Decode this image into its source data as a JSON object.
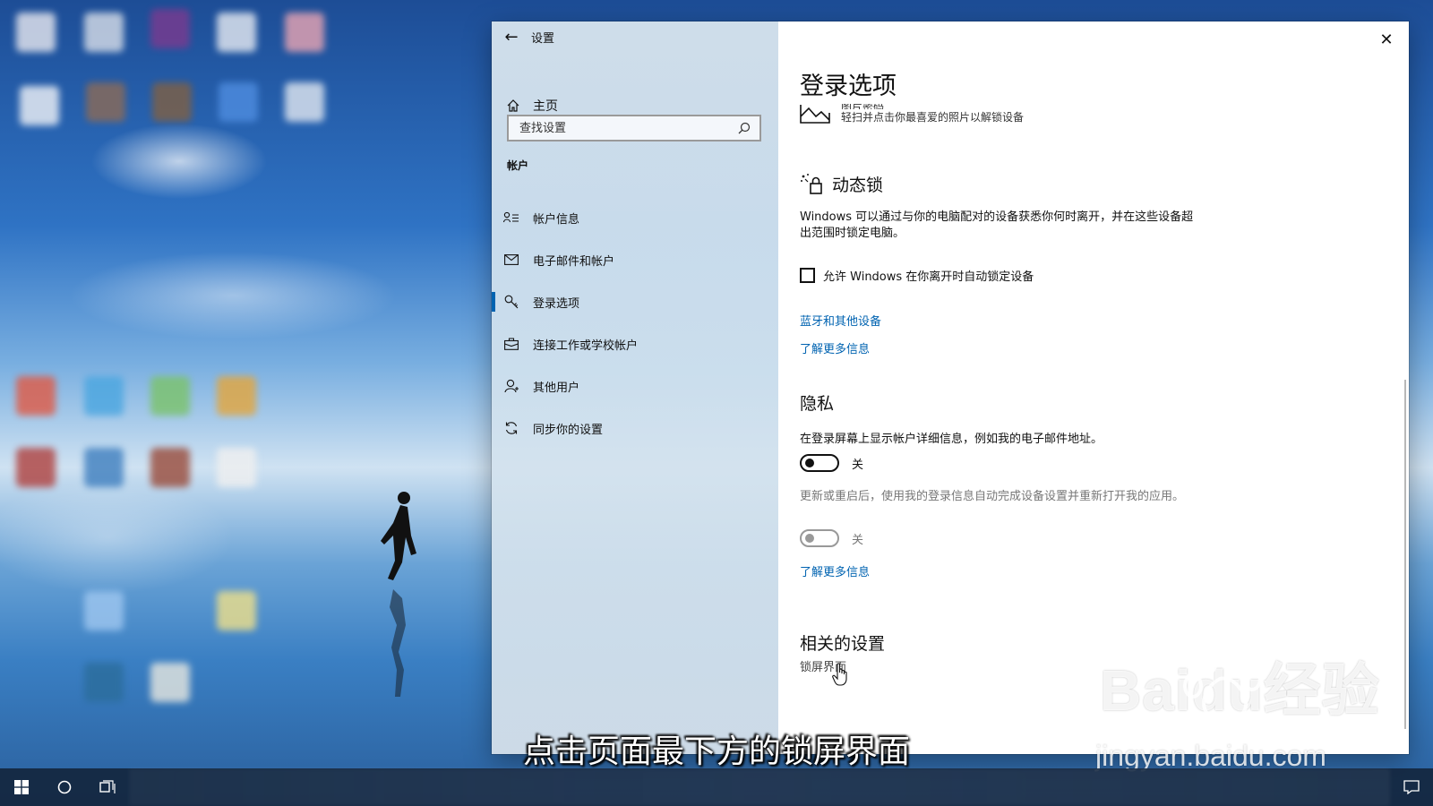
{
  "settings": {
    "window_title": "设置",
    "home_label": "主页",
    "search_placeholder": "查找设置",
    "section": "帐户",
    "nav_items": [
      {
        "label": "帐户信息"
      },
      {
        "label": "电子邮件和帐户"
      },
      {
        "label": "登录选项",
        "active": true
      },
      {
        "label": "连接工作或学校帐户"
      },
      {
        "label": "其他用户"
      },
      {
        "label": "同步你的设置"
      }
    ],
    "accent_color": "#0063b1"
  },
  "content": {
    "page_title": "登录选项",
    "picture_password": {
      "title_partial": "图片密码",
      "description": "轻扫并点击你最喜爱的照片以解锁设备"
    },
    "dynamic_lock": {
      "title": "动态锁",
      "description": "Windows 可以通过与你的电脑配对的设备获悉你何时离开，并在这些设备超出范围时锁定电脑。",
      "checkbox_label": "允许 Windows 在你离开时自动锁定设备",
      "checkbox_checked": false,
      "link_bluetooth": "蓝牙和其他设备",
      "link_learn_more": "了解更多信息"
    },
    "privacy": {
      "title": "隐私",
      "setting1": "在登录屏幕上显示帐户详细信息，例如我的电子邮件地址。",
      "toggle1_state": "关",
      "setting2": "更新或重启后，使用我的登录信息自动完成设备设置并重新打开我的应用。",
      "toggle2_state": "关",
      "link_learn_more": "了解更多信息"
    },
    "related": {
      "title": "相关的设置",
      "lock_screen": "锁屏界面"
    }
  },
  "overlay": {
    "caption": "点击页面最下方的锁屏界面",
    "watermark_main": "Baidu经验",
    "watermark_sub": "jingyan.baidu.com"
  }
}
